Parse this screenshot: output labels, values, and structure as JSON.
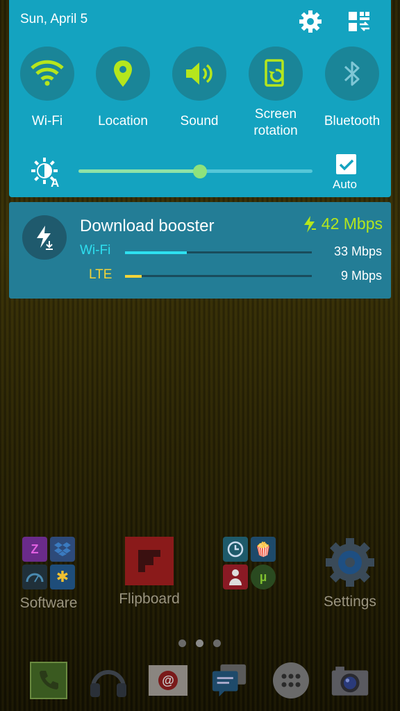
{
  "status": {
    "date": "Sun, April 5"
  },
  "top_icons": [
    "settings-gear-icon",
    "edit-tiles-icon"
  ],
  "quick_toggles": [
    {
      "label": "Wi-Fi",
      "icon": "wifi-icon"
    },
    {
      "label": "Location",
      "icon": "location-pin-icon"
    },
    {
      "label": "Sound",
      "icon": "speaker-icon"
    },
    {
      "label": "Screen\nrotation",
      "label_line1": "Screen",
      "label_line2": "rotation",
      "icon": "screen-rotation-icon"
    },
    {
      "label": "Bluetooth",
      "icon": "bluetooth-icon"
    }
  ],
  "brightness": {
    "level_percent": 52,
    "auto_checked": true,
    "auto_label": "Auto"
  },
  "download_booster": {
    "title": "Download booster",
    "total_speed": "42 Mbps",
    "wifi": {
      "label": "Wi-Fi",
      "speed": "33 Mbps",
      "fill_fraction": 0.33
    },
    "lte": {
      "label": "LTE",
      "speed": "9 Mbps",
      "fill_fraction": 0.09
    }
  },
  "home_apps": [
    {
      "label": "Software"
    },
    {
      "label": "Flipboard"
    },
    {
      "label": ""
    },
    {
      "label": "Settings"
    }
  ],
  "page_indicator": {
    "count": 3,
    "active": 1
  },
  "dock": [
    "phone-icon",
    "headphones-icon",
    "email-icon",
    "messages-icon",
    "apps-grid-icon",
    "camera-icon"
  ],
  "colors": {
    "panel": "#14a3c0",
    "toggle_on": "#b5e61d",
    "notification": "#237d96",
    "wifi_bar": "#2ee0f0",
    "lte_bar": "#f2d43a",
    "speed_green": "#b5e61d"
  }
}
